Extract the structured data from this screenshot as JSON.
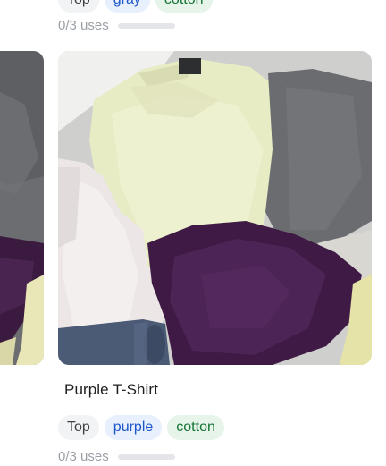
{
  "previous_card": {
    "tags": [
      {
        "label": "Top",
        "kind": "type"
      },
      {
        "label": "gray",
        "kind": "color"
      },
      {
        "label": "cotton",
        "kind": "material"
      }
    ],
    "usage_label": "0/3 uses",
    "usage_fraction": 0
  },
  "current_card": {
    "title": "Purple T-Shirt",
    "tags": [
      {
        "label": "Top",
        "kind": "type"
      },
      {
        "label": "purple",
        "kind": "color"
      },
      {
        "label": "cotton",
        "kind": "material"
      }
    ],
    "usage_label": "0/3 uses",
    "usage_fraction": 0
  },
  "colors": {
    "type_tag_bg": "#f1f3f4",
    "color_tag_bg": "#e8f0fe",
    "material_tag_bg": "#e6f4ea",
    "usage_track": "#e3e5e8"
  }
}
